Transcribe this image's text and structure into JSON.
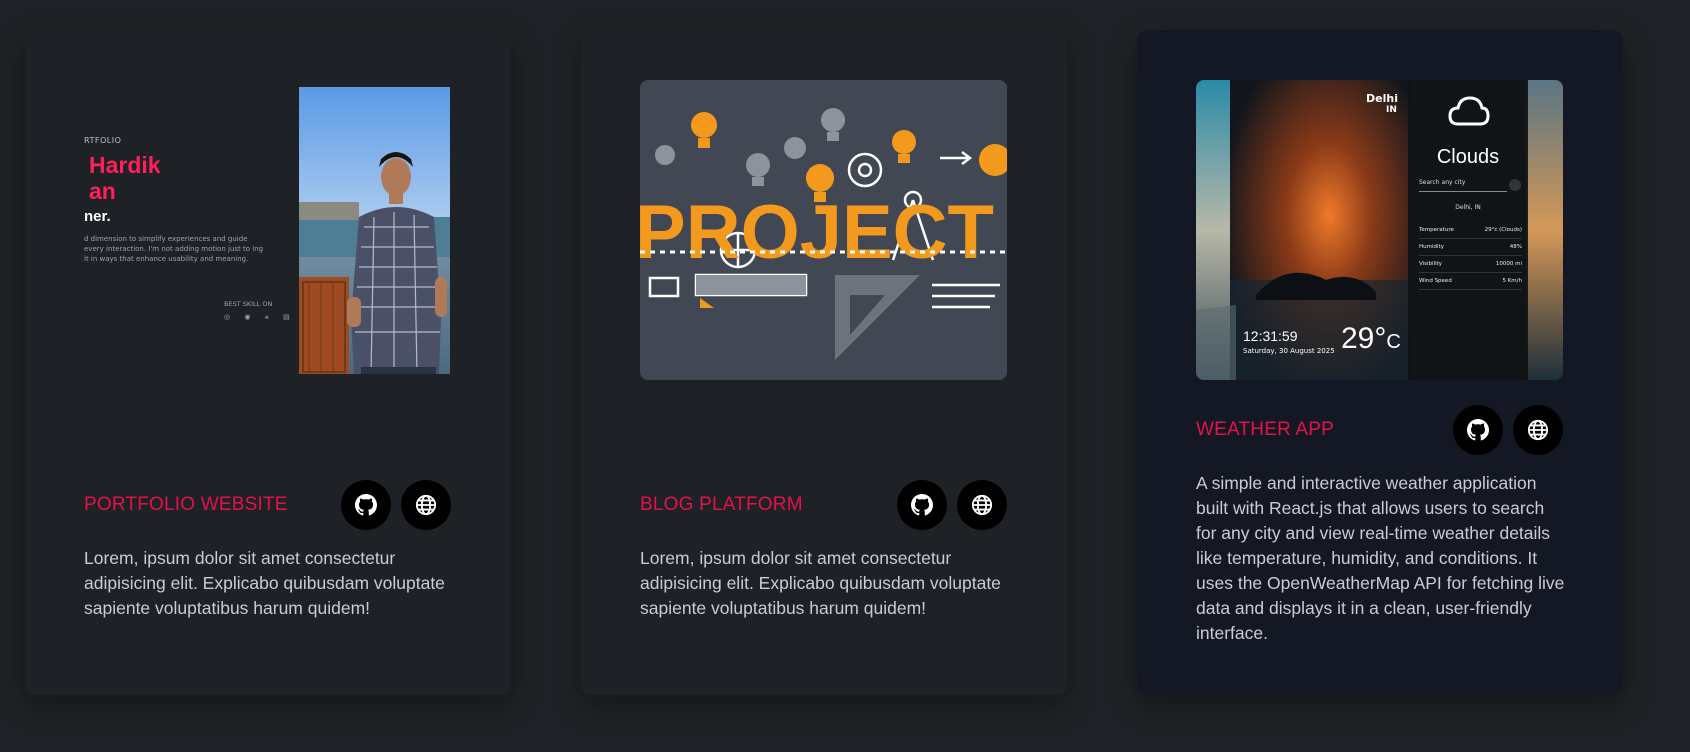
{
  "cards": [
    {
      "title": "PORTFOLIO WEBSITE",
      "description": "Lorem, ipsum dolor sit amet consectetur adipisicing elit. Explicabo quibusdam voluptate sapiente voluptatibus harum quidem!",
      "thumbnail": {
        "label": "RTFOLIO",
        "name_line1": "Hardik",
        "name_line2": "an",
        "role": "ner.",
        "tagline": "d dimension to simplify experiences and guide every interaction. I'm not adding motion just to ing it in ways that enhance usability and meaning.",
        "skill_label": "BEST SKILL ON",
        "skill_icons": "◎ ◉ ⚹ ▤"
      }
    },
    {
      "title": "BLOG PLATFORM",
      "description": "Lorem, ipsum dolor sit amet consectetur adipisicing elit. Explicabo quibusdam voluptate sapiente voluptatibus harum quidem!",
      "thumbnail": {
        "banner_text": "PROJECT"
      }
    },
    {
      "title": "WEATHER APP",
      "description": "A simple and interactive weather application built with React.js that allows users to search for any city and view real-time weather details like temperature, humidity, and conditions. It uses the OpenWeatherMap API for fetching live data and displays it in a clean, user-friendly interface.",
      "thumbnail": {
        "city": "Delhi",
        "country": "IN",
        "condition": "Clouds",
        "search_placeholder": "Search any city",
        "city_row": "Delhi, IN",
        "stats": [
          {
            "label": "Temperature",
            "value": "29°c (Clouds)"
          },
          {
            "label": "Humidity",
            "value": "48%"
          },
          {
            "label": "Visibility",
            "value": "10000 mi"
          },
          {
            "label": "Wind Speed",
            "value": "5 Km/h"
          }
        ],
        "time": "12:31:59",
        "date": "Saturday, 30 August 2025",
        "temperature": "29°",
        "unit": "C"
      }
    }
  ],
  "icons": {
    "repo": "github-icon",
    "live": "globe-icon"
  },
  "colors": {
    "title_accent": "#e5114b",
    "page_bg": "#1f2226",
    "card_bg": "#1e2126",
    "button_bg": "#000000"
  }
}
